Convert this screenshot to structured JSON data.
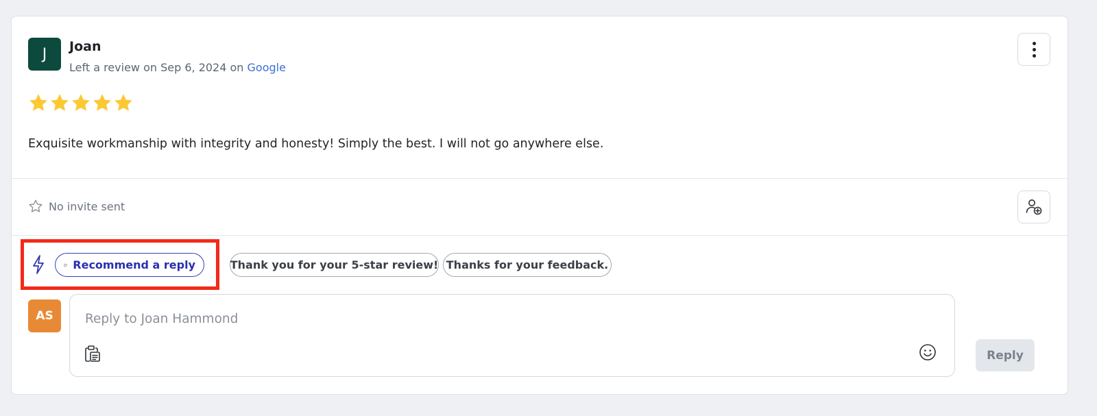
{
  "review": {
    "avatar_initial": "J",
    "reviewer_name": "Joan",
    "meta_prefix": "Left a review on Sep 6, 2024 on ",
    "source": "Google",
    "rating": 5,
    "text": "Exquisite workmanship with integrity and honesty! Simply the best. I will not go anywhere else."
  },
  "invite": {
    "status": "No invite sent"
  },
  "suggestions": {
    "recommend_label": "Recommend a reply",
    "chips": [
      "Thank you for your 5-star review!",
      "Thanks for your feedback."
    ]
  },
  "reply": {
    "avatar_initials": "AS",
    "placeholder": "Reply to Joan Hammond",
    "value": "",
    "button_label": "Reply"
  },
  "colors": {
    "star": "#fcc934",
    "avatar_j": "#0d4a3e",
    "avatar_as": "#e88a35",
    "source_link": "#3b6fd6",
    "highlight": "#f32a1a",
    "recommend_accent": "#2a2fb0"
  },
  "icons": {
    "more": "vertical-dots-icon",
    "invite": "star-outline-icon",
    "add_person": "add-person-icon",
    "bolt": "lightning-bolt-icon",
    "recommend": "chat-bubble-icon",
    "template": "clipboard-icon",
    "emoji": "smiley-icon"
  }
}
